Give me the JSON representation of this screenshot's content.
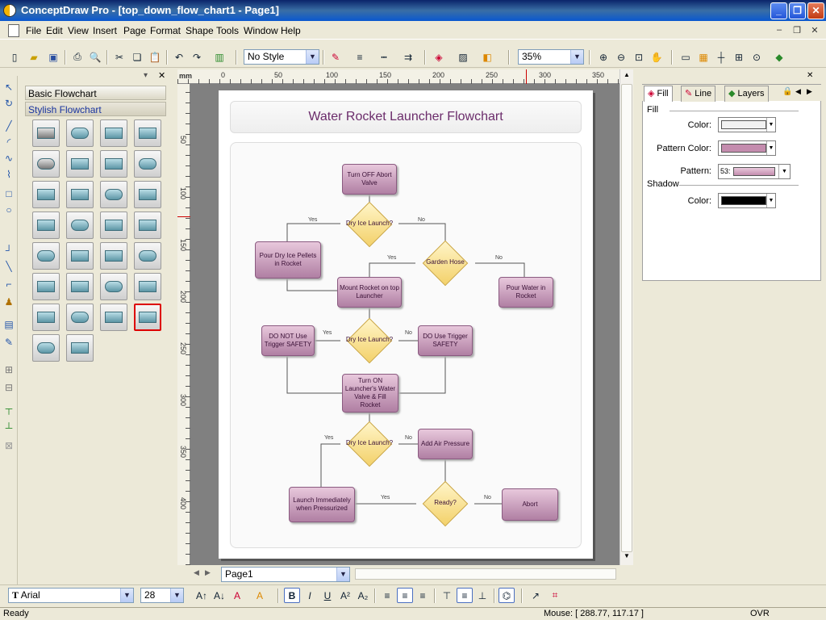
{
  "window": {
    "title": "ConceptDraw Pro - [top_down_flow_chart1 - Page1]"
  },
  "menu": [
    "File",
    "Edit",
    "View",
    "Insert",
    "Page",
    "Format",
    "Shape",
    "Tools",
    "Window",
    "Help"
  ],
  "toolbar": {
    "style_value": "No Style",
    "zoom_value": "35%"
  },
  "library": {
    "tab_basic": "Basic Flowchart",
    "tab_stylish": "Stylish Flowchart"
  },
  "ruler": {
    "h_labels": [
      "0",
      "50",
      "100",
      "150",
      "200",
      "250",
      "300",
      "350"
    ],
    "h_unit": "mm",
    "v_labels": [
      "50",
      "100",
      "150",
      "200",
      "250",
      "300",
      "350",
      "400"
    ]
  },
  "diagram": {
    "title": "Water Rocket Launcher Flowchart",
    "nodes": {
      "n1": "Turn OFF Abort Valve",
      "d1": "Dry Ice Launch?",
      "n2": "Pour Dry Ice Pellets in Rocket",
      "d2": "Garden Hose",
      "n3": "Mount Rocket on top Launcher",
      "n4": "Pour Water in Rocket",
      "d3": "Dry Ice Launch?",
      "n5": "DO NOT Use Trigger SAFETY",
      "n6": "DO Use Trigger SAFETY",
      "n7": "Turn ON Launcher's Water Valve & Fill Rocket",
      "d4": "Dry Ice Launch?",
      "n8": "Add Air Pressure",
      "d5": "Ready?",
      "n9": "Launch Immediately when Pressurized",
      "n10": "Abort"
    },
    "labels": {
      "yes": "Yes",
      "no": "No"
    }
  },
  "page_tab": "Page1",
  "props": {
    "tabs": [
      "Fill",
      "Line",
      "Layers"
    ],
    "fill_section": "Fill",
    "shadow_section": "Shadow",
    "color_label": "Color:",
    "pattern_color_label": "Pattern Color:",
    "pattern_label": "Pattern:",
    "pattern_value": "53:",
    "colors": {
      "fill": "#F2F2F2",
      "pattern": "#C48CAE",
      "shadow": "#000000"
    }
  },
  "format": {
    "font": "Arial",
    "size": "28"
  },
  "status": {
    "left": "Ready",
    "mouse": "Mouse: [ 288.77, 117.17 ]",
    "ovr": "OVR"
  }
}
